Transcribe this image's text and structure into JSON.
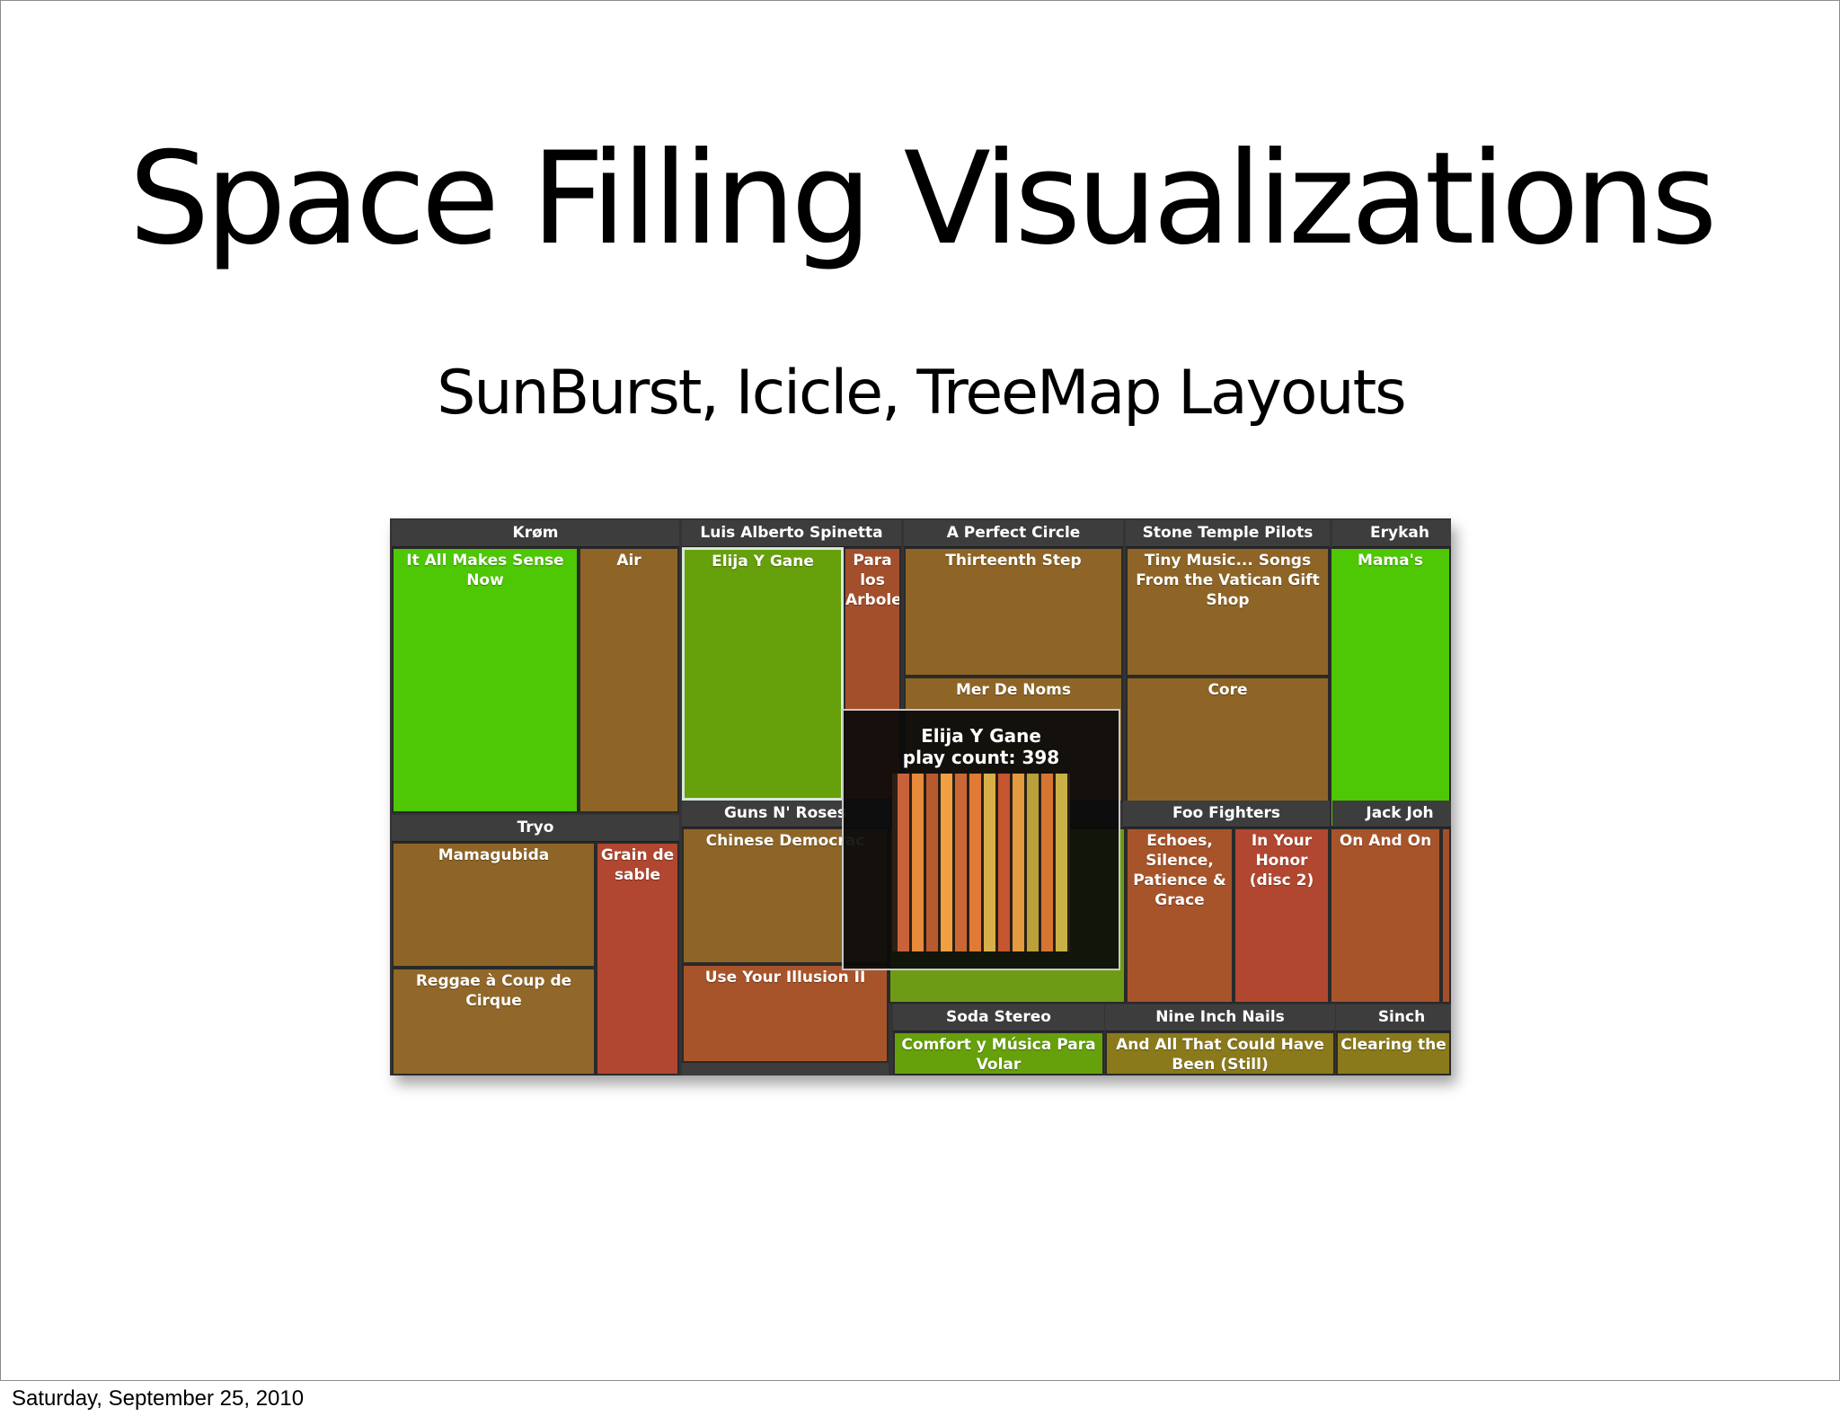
{
  "slide": {
    "title": "Space Filling Visualizations",
    "subtitle": "SunBurst, Icicle, TreeMap Layouts",
    "footer": "Saturday, September 25, 2010"
  },
  "treemap": {
    "groups": {
      "krom": "Krøm",
      "spinetta": "Luis Alberto Spinetta",
      "perfect_circle": "A Perfect Circle",
      "stp": "Stone Temple Pilots",
      "erykah": "Erykah",
      "tryo": "Tryo",
      "guns": "Guns N' Roses",
      "foo": "Foo Fighters",
      "jack": "Jack Joh",
      "soda": "Soda Stereo",
      "nin": "Nine Inch Nails",
      "sinch": "Sinch"
    },
    "cells": {
      "it_all": "It All Makes Sense Now",
      "air": "Air",
      "elija": "Elija Y Gane",
      "para_los": "Para los Arboles",
      "thirteenth": "Thirteenth Step",
      "tiny_music": "Tiny Music... Songs From the Vatican Gift Shop",
      "mamas": "Mama's",
      "mer_de_noms": "Mer De Noms",
      "core": "Core",
      "mamagubida": "Mamagubida",
      "grain": "Grain de sable",
      "chinese": "Chinese Democrac",
      "echoes": "Echoes, Silence, Patience & Grace",
      "in_your_honor": "In Your Honor (disc 2)",
      "on_and_on": "On And On",
      "reggae": "Reggae à Coup de Cirque",
      "use_your": "Use Your Illusion II",
      "comfort": "Comfort y Música Para Volar",
      "and_all": "And All That Could Have Been (Still)",
      "clearing": "Clearing the"
    },
    "tooltip": {
      "title": "Elija Y Gane",
      "count_text": "play count: 398"
    }
  },
  "colors": {
    "green": "#4ec704",
    "olive": "#66a00b",
    "brown": "#8e6527",
    "rust": "#a44f2b",
    "header": "#3d3d3d"
  }
}
